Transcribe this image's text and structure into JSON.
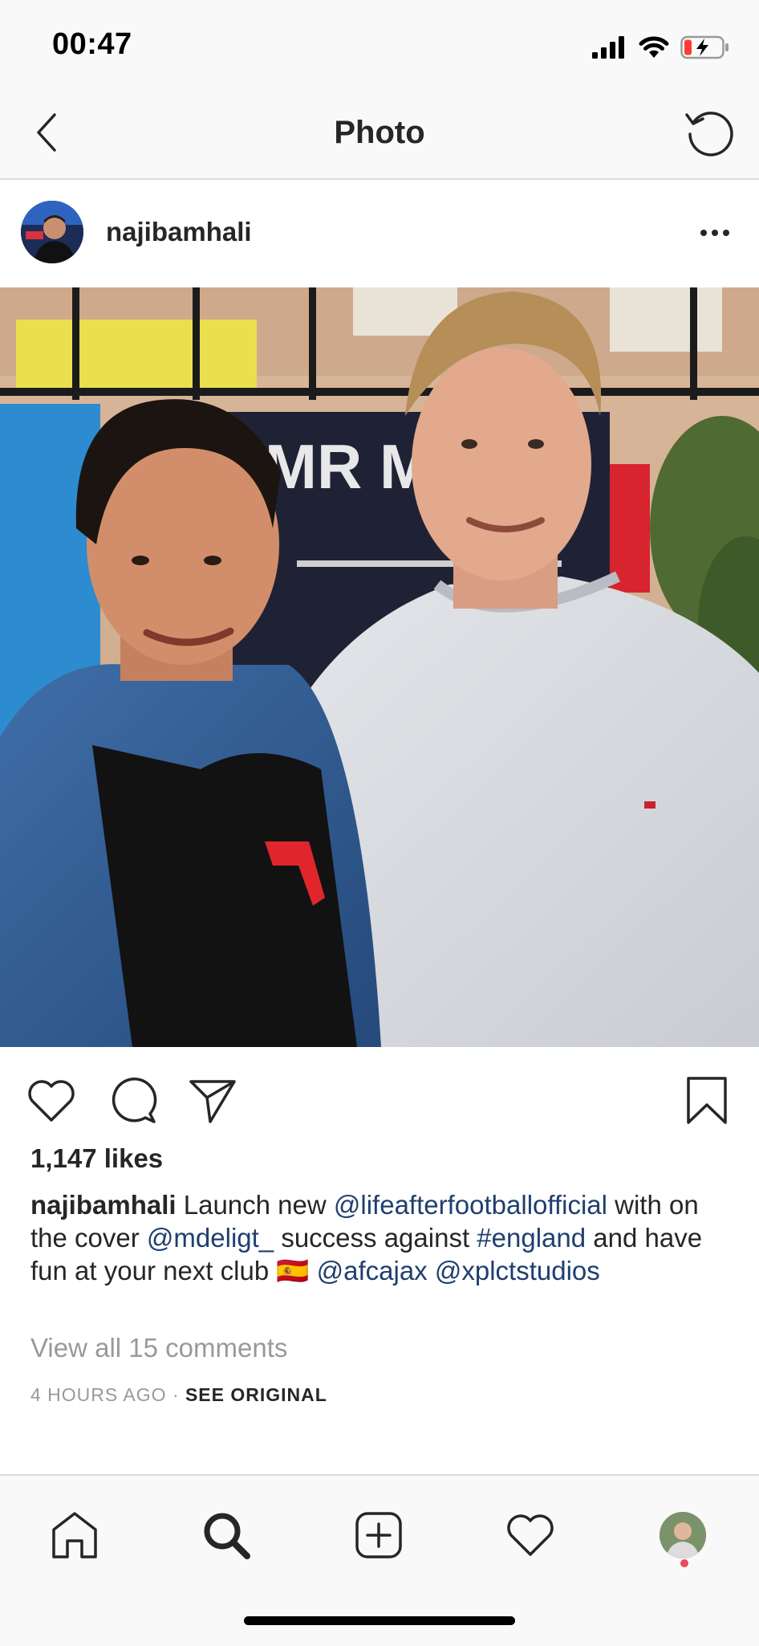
{
  "status_bar": {
    "time": "00:47"
  },
  "nav": {
    "title": "Photo"
  },
  "post": {
    "username": "najibamhali",
    "likes": "1,147 likes",
    "caption": {
      "username": "najibamhali",
      "t1": "Launch new",
      "mention1": "@lifeafterfootballofficial",
      "t2": "with on the cover",
      "mention2": "@mdeligt_",
      "t3": "success against",
      "hashtag": "#england",
      "t4": "and have fun at your next club",
      "emoji": "🇪🇸",
      "mention3": "@afcajax",
      "mention4": "@xplctstudios"
    },
    "view_comments": "View all 15 comments",
    "time_ago": "4 HOURS AGO",
    "separator": "·",
    "see_original": "SEE ORIGINAL"
  },
  "colors": {
    "link": "#1f3f6e",
    "muted": "#999999",
    "text": "#262626",
    "bar_background": "#f9f9f9",
    "notification": "#ed4956"
  },
  "icons": {
    "status": [
      "signal-icon",
      "wifi-icon",
      "battery-charging-icon"
    ],
    "nav": [
      "back-chevron-icon",
      "refresh-icon"
    ],
    "actions": [
      "heart-icon",
      "comment-icon",
      "share-icon",
      "bookmark-icon"
    ],
    "tabs": [
      "home-icon",
      "search-icon",
      "add-post-icon",
      "activity-heart-icon",
      "profile-avatar"
    ]
  }
}
